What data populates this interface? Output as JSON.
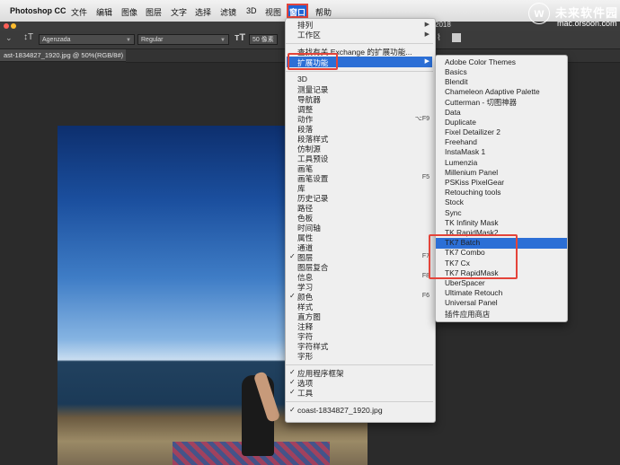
{
  "menubar": {
    "app_name": "Photoshop CC",
    "items": [
      "文件",
      "编辑",
      "图像",
      "图层",
      "文字",
      "选择",
      "滤镜",
      "3D",
      "视图",
      "窗口",
      "帮助"
    ]
  },
  "title_bar": {
    "year_fragment": "2018"
  },
  "options_bar": {
    "font_family": "Agenzada",
    "font_style": "Regular",
    "font_size": "50 像素"
  },
  "document": {
    "tab_label": "ast-1834827_1920.jpg @ 50%(RGB/8#)"
  },
  "window_menu": {
    "top_items": [
      {
        "label": "排列",
        "has_submenu": true
      },
      {
        "label": "工作区",
        "has_submenu": true
      }
    ],
    "exchange_item": "查找有关 Exchange 的扩展功能...",
    "extensions_item": "扩展功能",
    "panels": [
      {
        "label": "3D"
      },
      {
        "label": "测量记录"
      },
      {
        "label": "导航器"
      },
      {
        "label": "调整"
      },
      {
        "label": "动作",
        "shortcut": "⌥F9"
      },
      {
        "label": "段落"
      },
      {
        "label": "段落样式"
      },
      {
        "label": "仿制源"
      },
      {
        "label": "工具预设"
      },
      {
        "label": "画笔"
      },
      {
        "label": "画笔设置",
        "shortcut": "F5"
      },
      {
        "label": "库"
      },
      {
        "label": "历史记录"
      },
      {
        "label": "路径"
      },
      {
        "label": "色板"
      },
      {
        "label": "时间轴"
      },
      {
        "label": "属性"
      },
      {
        "label": "通道"
      },
      {
        "label": "图层",
        "checked": true,
        "shortcut": "F7"
      },
      {
        "label": "图层复合"
      },
      {
        "label": "信息",
        "shortcut": "F8"
      },
      {
        "label": "学习"
      },
      {
        "label": "颜色",
        "checked": true,
        "shortcut": "F6"
      },
      {
        "label": "样式"
      },
      {
        "label": "直方图"
      },
      {
        "label": "注释"
      },
      {
        "label": "字符"
      },
      {
        "label": "字符样式"
      },
      {
        "label": "字形"
      }
    ],
    "frame_items": [
      {
        "label": "应用程序框架",
        "checked": true
      },
      {
        "label": "选项",
        "checked": true
      },
      {
        "label": "工具",
        "checked": true
      }
    ],
    "document_item": {
      "label": "coast-1834827_1920.jpg",
      "checked": true
    }
  },
  "extensions_submenu": {
    "items": [
      "Adobe Color Themes",
      "Basics",
      "Blendit",
      "Chameleon Adaptive Palette",
      "Cutterman - 切图神器",
      "Data",
      "Duplicate",
      "Fixel Detailizer 2",
      "Freehand",
      "InstaMask 1",
      "Lumenzia",
      "Millenium Panel",
      "PSKiss PixelGear",
      "Retouching tools",
      "Stock",
      "Sync",
      "TK Infinity Mask",
      "TK RapidMask2",
      "TK7 Batch",
      "TK7 Combo",
      "TK7 Cx",
      "TK7 RapidMask",
      "UberSpacer",
      "Ultimate Retouch",
      "Universal Panel",
      "插件应用商店"
    ],
    "highlighted": "TK7 Batch"
  },
  "watermark": {
    "title": "未来软件园",
    "url": "mac.orsoon.com"
  },
  "colors": {
    "highlight": "#2c6fd6",
    "annotation_red": "#e4443a"
  }
}
